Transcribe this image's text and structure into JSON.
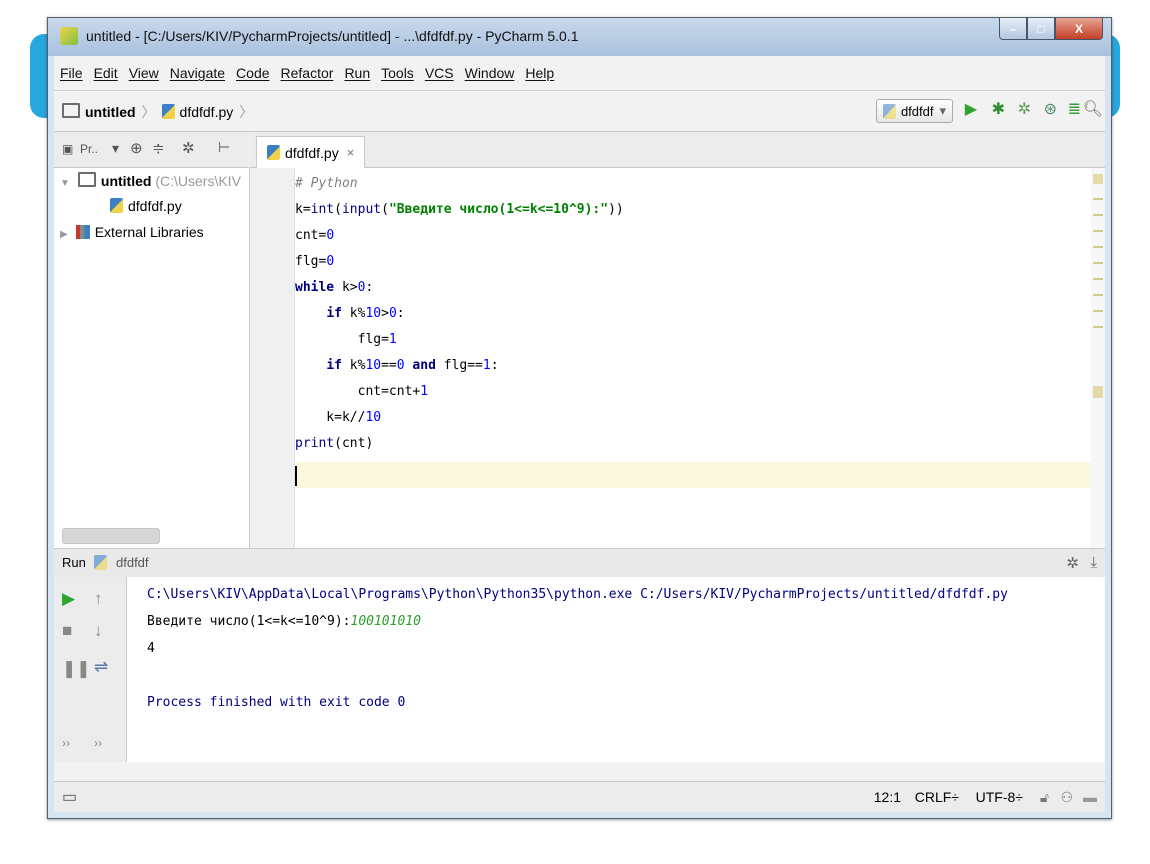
{
  "window": {
    "title": "untitled - [C:/Users/KIV/PycharmProjects/untitled] - ...\\dfdfdf.py - PyCharm 5.0.1",
    "min_glyph": "–",
    "max_glyph": "□",
    "close_glyph": "X"
  },
  "menu": [
    "File",
    "Edit",
    "View",
    "Navigate",
    "Code",
    "Refactor",
    "Run",
    "Tools",
    "VCS",
    "Window",
    "Help"
  ],
  "nav": {
    "project": "untitled",
    "file": "dfdfdf.py",
    "run_config": "dfdfdf",
    "run_config_arrow": "▾"
  },
  "toolwindow_label": "Pr..",
  "editor_tab": {
    "label": "dfdfdf.py",
    "close": "×"
  },
  "project_tree": {
    "root_name": "untitled",
    "root_path": "(C:\\Users\\KIV",
    "file": "dfdfdf.py",
    "libraries": "External Libraries"
  },
  "code": [
    "# Python",
    "k=int(input(\"Введите число(1<=k<=10^9):\"))",
    "cnt=0",
    "flg=0",
    "while k>0:",
    "    if k%10>0:",
    "        flg=1",
    "    if k%10==0 and flg==1:",
    "        cnt=cnt+1",
    "    k=k//10",
    "print(cnt)"
  ],
  "run": {
    "label": "Run",
    "config": "dfdfdf",
    "command": "C:\\Users\\KIV\\AppData\\Local\\Programs\\Python\\Python35\\python.exe C:/Users/KIV/PycharmProjects/untitled/dfdfdf.py",
    "prompt": "Введите число(1<=k<=10^9):",
    "user_input": "100101010",
    "result": "4",
    "finished": "Process finished with exit code 0"
  },
  "status": {
    "position": "12:1",
    "line_sep": "CRLF÷",
    "encoding": "UTF-8÷"
  },
  "icons": {
    "run": "run-icon",
    "debug": "debug-icon",
    "coverage": "coverage-icon",
    "profile": "profile-icon",
    "search": "search-icon",
    "settings": "gear-icon",
    "stop": "stop-icon",
    "pause": "pause-icon"
  },
  "colors": {
    "accent_bar": "#27a7de",
    "keyword": "#000080",
    "number": "#0000ff",
    "string": "#008000",
    "comment": "#808080",
    "run_green": "#2fa52f"
  }
}
